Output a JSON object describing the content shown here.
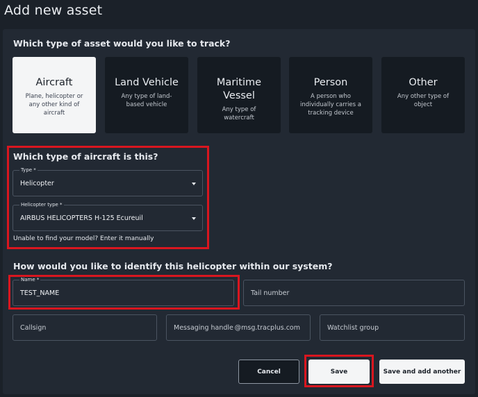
{
  "page": {
    "title": "Add new asset"
  },
  "asset_type": {
    "heading": "Which type of asset would you like to track?",
    "cards": [
      {
        "title": "Aircraft",
        "description": "Plane, helicopter or any other kind of aircraft",
        "selected": true
      },
      {
        "title": "Land Vehicle",
        "description": "Any type of land-based vehicle",
        "selected": false
      },
      {
        "title": "Maritime Vessel",
        "description": "Any type of watercraft",
        "selected": false
      },
      {
        "title": "Person",
        "description": "A person who individually carries a tracking device",
        "selected": false
      },
      {
        "title": "Other",
        "description": "Any other type of object",
        "selected": false
      }
    ]
  },
  "aircraft": {
    "heading": "Which type of aircraft is this?",
    "type_label": "Type *",
    "type_value": "Helicopter",
    "model_label": "Helicopter type *",
    "model_value": "AIRBUS HELICOPTERS H-125 Ecureuil",
    "manual_link": "Unable to find your model? Enter it manually"
  },
  "identify": {
    "heading": "How would you like to identify this helicopter within our system?",
    "name_label": "Name *",
    "name_value": "TEST_NAME",
    "tail_placeholder": "Tail number",
    "callsign_placeholder": "Callsign",
    "messaging_placeholder": "Messaging handle",
    "messaging_suffix": "@msg.tracplus.com",
    "watchlist_placeholder": "Watchlist group"
  },
  "actions": {
    "cancel": "Cancel",
    "save": "Save",
    "save_another": "Save and add another"
  },
  "colors": {
    "background": "#1b2129",
    "panel": "#222933",
    "highlight": "#d9161f",
    "selected_card": "#f4f5f6"
  }
}
